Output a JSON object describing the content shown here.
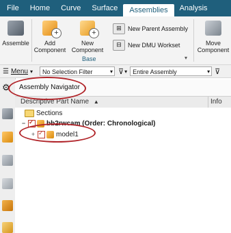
{
  "menubar": {
    "tabs": [
      "File",
      "Home",
      "Curve",
      "Surface",
      "Assemblies",
      "Analysis"
    ],
    "active": "Assemblies"
  },
  "ribbon": {
    "assemble": "Assemble",
    "add_component_1": "Add",
    "add_component_2": "Component",
    "new_component_1": "New",
    "new_component_2": "Component",
    "new_parent_assembly": "New Parent Assembly",
    "new_dmu_workset": "New DMU Workset",
    "group_base": "Base",
    "move_component_1": "Move",
    "move_component_2": "Component"
  },
  "filterbar": {
    "menu_label": "Menu",
    "selection_filter": "No Selection Filter",
    "scope": "Entire Assembly"
  },
  "navigator": {
    "title": "Assembly Navigator",
    "col_name": "Descriptive Part Name",
    "col_info": "Info",
    "rows": [
      {
        "label": "Sections"
      },
      {
        "label": "bb2rwcam (Order: Chronological)"
      },
      {
        "label": "model1"
      }
    ]
  },
  "colors": {
    "menubar": "#1f5f7c",
    "annotation": "#b1252a"
  }
}
